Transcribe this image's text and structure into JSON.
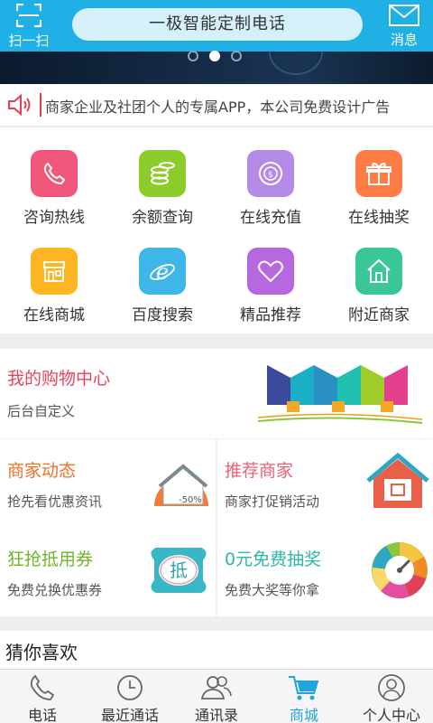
{
  "header": {
    "scan_label": "扫一扫",
    "title": "一极智能定制电话",
    "message_label": "消息"
  },
  "banner": {
    "page_count": 3,
    "active_page": 2
  },
  "notice": {
    "text": "商家企业及社团个人的专属APP，本公司免费设计广告"
  },
  "grid": {
    "items": [
      {
        "label": "咨询热线",
        "icon": "phone-icon",
        "color": "#f0577a"
      },
      {
        "label": "余额查询",
        "icon": "coins-icon",
        "color": "#8ccc2a"
      },
      {
        "label": "在线充值",
        "icon": "recharge-icon",
        "color": "#b38ae6"
      },
      {
        "label": "在线抽奖",
        "icon": "gift-icon",
        "color": "#ff7d45"
      },
      {
        "label": "在线商城",
        "icon": "store-icon",
        "color": "#ffb51f"
      },
      {
        "label": "百度搜索",
        "icon": "browser-icon",
        "color": "#3eb6e8"
      },
      {
        "label": "精品推荐",
        "icon": "heart-icon",
        "color": "#b767e0"
      },
      {
        "label": "附近商家",
        "icon": "home-icon",
        "color": "#39c79a"
      }
    ]
  },
  "shop": {
    "title": "我的购物中心",
    "subtitle": "后台自定义"
  },
  "panels": {
    "merchant_news": {
      "title": "商家动态",
      "subtitle": "抢先看优惠资讯",
      "badge": "-50%"
    },
    "recommend": {
      "title": "推荐商家",
      "subtitle": "商家打促销活动"
    },
    "coupon": {
      "title": "狂抢抵用券",
      "subtitle": "免费兑换优惠券",
      "badge": "抵"
    },
    "lottery": {
      "title": "0元免费抽奖",
      "subtitle": "免费大奖等你拿"
    }
  },
  "guess": {
    "title": "猜你喜欢"
  },
  "tabs": [
    {
      "label": "电话",
      "icon": "phone-icon"
    },
    {
      "label": "最近通话",
      "icon": "clock-icon"
    },
    {
      "label": "通讯录",
      "icon": "contacts-icon"
    },
    {
      "label": "商城",
      "icon": "cart-icon",
      "active": true
    },
    {
      "label": "个人中心",
      "icon": "user-icon"
    }
  ],
  "colors": {
    "primary": "#1fb1e6",
    "shop_title": "#e8445a",
    "news_title": "#f07026",
    "recommend_title": "#ef5f7a",
    "coupon_title": "#6eb52a",
    "lottery_title": "#2cb8a4",
    "active_tab": "#1fa6df"
  }
}
